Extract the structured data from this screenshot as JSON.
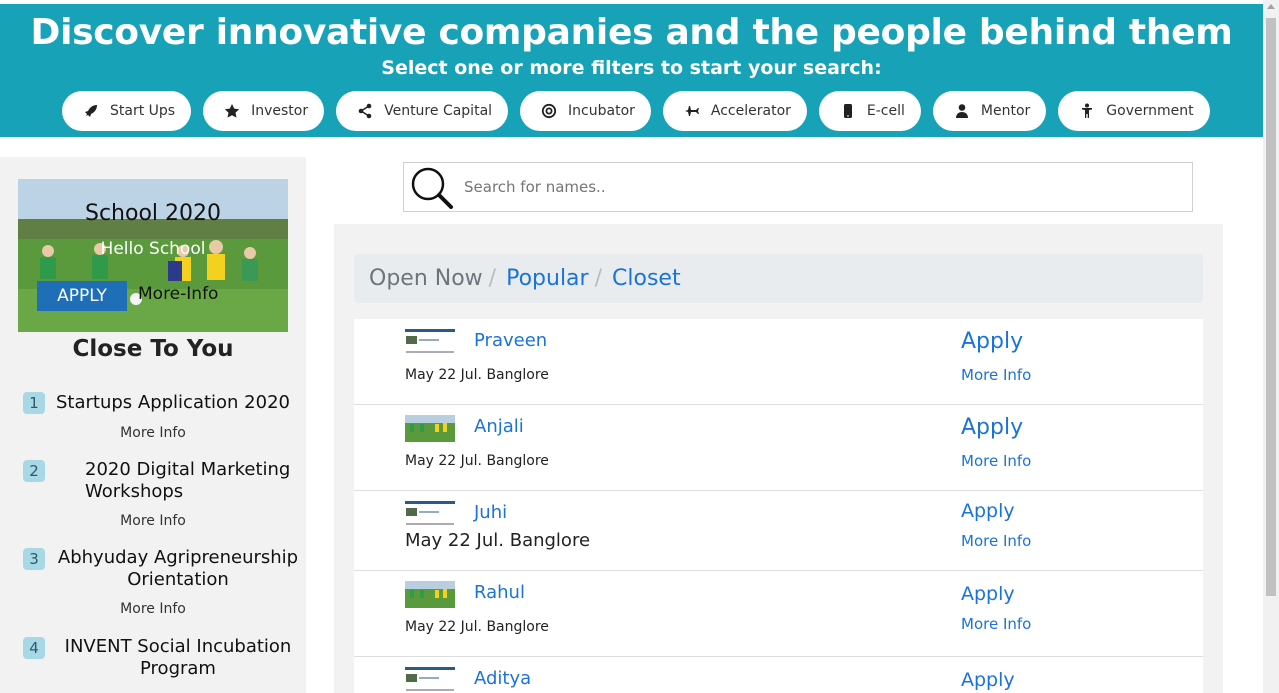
{
  "header": {
    "title": "Discover innovative companies and the people behind them",
    "subtitle": "Select one or more filters to start your search:"
  },
  "filters": [
    {
      "label": "Start Ups",
      "icon": "rocket-icon"
    },
    {
      "label": "Investor",
      "icon": "star-icon"
    },
    {
      "label": "Venture Capital",
      "icon": "share-icon"
    },
    {
      "label": "Incubator",
      "icon": "target-icon"
    },
    {
      "label": "Accelerator",
      "icon": "plane-icon"
    },
    {
      "label": "E-cell",
      "icon": "phone-icon"
    },
    {
      "label": "Mentor",
      "icon": "user-icon"
    },
    {
      "label": "Government",
      "icon": "person-icon"
    }
  ],
  "sidebar": {
    "banner": {
      "title": "School 2020",
      "subtitle": "Hello School",
      "apply_label": "APPLY",
      "more_label": "More-Info"
    },
    "section_title": "Close To You",
    "items": [
      {
        "num": "1",
        "title": "Startups Application 2020",
        "more": "More Info"
      },
      {
        "num": "2",
        "title": "2020 Digital Marketing Workshops",
        "more": "More Info"
      },
      {
        "num": "3",
        "title": "Abhyuday Agripreneurship Orientation",
        "more": "More Info"
      },
      {
        "num": "4",
        "title": "INVENT Social Incubation Program",
        "more": ""
      }
    ]
  },
  "search": {
    "placeholder": "Search for names.."
  },
  "breadcrumb": {
    "current": "Open Now",
    "links": [
      "Popular",
      "Closet"
    ]
  },
  "results": [
    {
      "name": "Praveen",
      "meta": "May 22 Jul. Banglore",
      "apply": "Apply",
      "more": "More Info",
      "thumb": "screenshot"
    },
    {
      "name": "Anjali",
      "meta": "May 22 Jul. Banglore",
      "apply": "Apply",
      "more": "More Info",
      "thumb": "field"
    },
    {
      "name": "Juhi",
      "meta": "May 22 Jul. Banglore",
      "apply": "Apply",
      "more": "More Info",
      "thumb": "screenshot"
    },
    {
      "name": "Rahul",
      "meta": "May 22 Jul. Banglore",
      "apply": "Apply",
      "more": "More Info",
      "thumb": "field"
    },
    {
      "name": "Aditya",
      "meta": "",
      "apply": "Apply",
      "more": "",
      "thumb": "screenshot"
    }
  ],
  "colors": {
    "header_bg": "#17a2b8",
    "link": "#1a73d9",
    "badge": "#a8d8e6",
    "apply_button": "#1f6fb8"
  }
}
